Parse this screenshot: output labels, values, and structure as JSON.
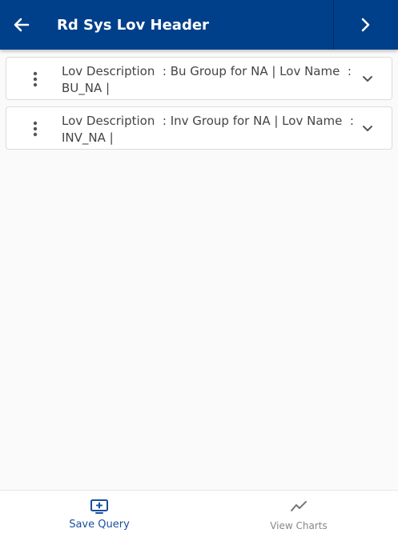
{
  "header": {
    "title": "Rd Sys Lov Header",
    "back_icon": "arrow-left-icon",
    "next_icon": "chevron-right-icon",
    "color": "#003f8a"
  },
  "records": [
    {
      "line1": "Lov Description  : Bu Group for NA | Lov Name  :",
      "line2": "BU_NA |"
    },
    {
      "line1": "Lov Description  : Inv Group for NA | Lov Name  :",
      "line2": "INV_NA |"
    }
  ],
  "bottom_nav": {
    "save_query": {
      "label": "Save Query",
      "icon": "monitor-plus-icon",
      "color": "#1a4f9c"
    },
    "view_charts": {
      "label": "View Charts",
      "icon": "trend-line-icon",
      "color": "#888888"
    }
  }
}
